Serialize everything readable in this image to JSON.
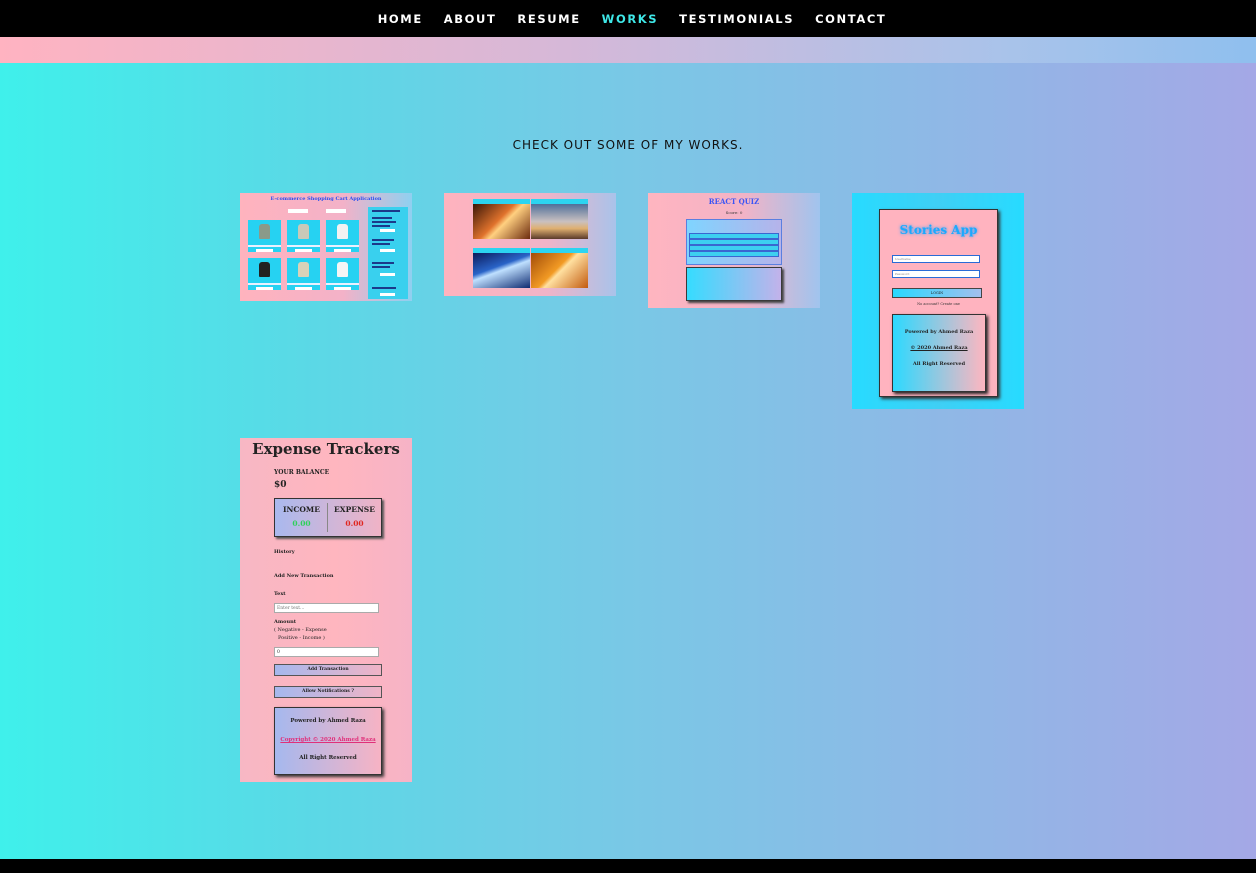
{
  "nav": {
    "items": [
      {
        "label": "HOME"
      },
      {
        "label": "ABOUT"
      },
      {
        "label": "RESUME"
      },
      {
        "label": "WORKS"
      },
      {
        "label": "TESTIMONIALS"
      },
      {
        "label": "CONTACT"
      }
    ],
    "active_color": "#3fe8e8"
  },
  "works": {
    "heading": "CHECK OUT SOME OF MY WORKS."
  },
  "projects": {
    "shopping": {
      "title": "E-commerce Shopping Cart Application"
    },
    "gallery": {},
    "quiz": {
      "title": "REACT QUIZ",
      "subtitle": "Score: 0"
    },
    "stories": {
      "title": "Stories App",
      "username_placeholder": "Username",
      "password_placeholder": "Password",
      "login_label": "LOGIN",
      "signup_text": "No account? Create one",
      "footer": [
        "Powered by Ahmed Raza",
        "© 2020 Ahmed Raza",
        "All Right Reserved"
      ]
    },
    "expense": {
      "title": "Expense Trackers",
      "balance_label": "YOUR BALANCE",
      "balance": "$0",
      "income_label": "INCOME",
      "income": "0.00",
      "expense_label": "EXPENSE",
      "expense": "0.00",
      "history_label": "History",
      "add_label": "Add New Transaction",
      "text_label": "Text",
      "text_placeholder": "Enter text...",
      "amount_label": "Amount",
      "amount_hint_1": "( Negative - Expense",
      "amount_hint_2": "Positive - Income )",
      "amount_value": "0",
      "add_button": "Add Transaction",
      "notify_button": "Allow Notifications ?",
      "footer": [
        "Powered by Ahmed Raza",
        "Copyright © 2020 Ahmed Raza",
        "All Right Reserved"
      ]
    }
  }
}
